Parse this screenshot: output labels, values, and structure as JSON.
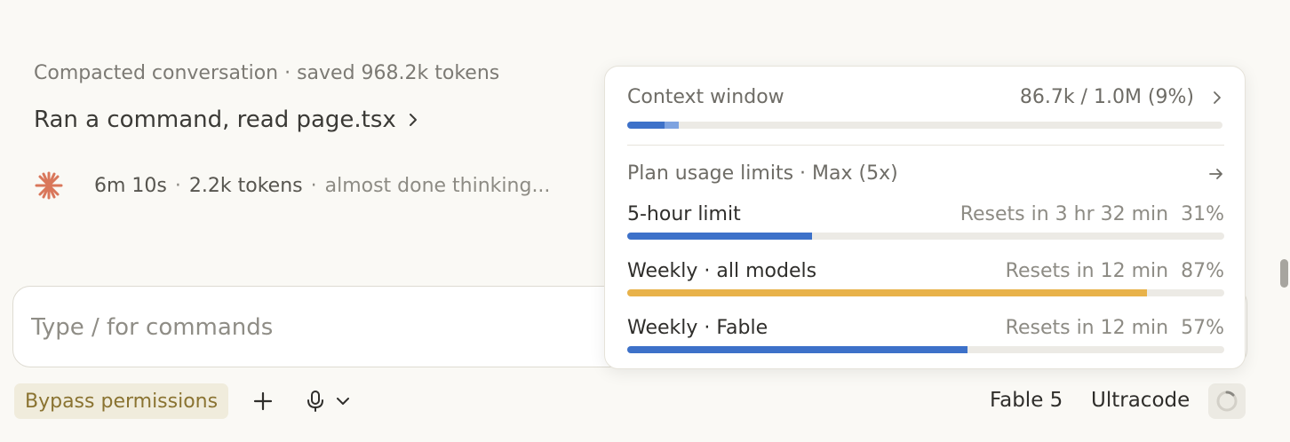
{
  "conversation": {
    "compact_note": "Compacted conversation · saved 968.2k tokens",
    "ran_command": "Ran a command, read page.tsx",
    "thinking": {
      "elapsed": "6m 10s",
      "sep1": "·",
      "tokens": "2.2k tokens",
      "sep2": "·",
      "status": "almost done thinking..."
    }
  },
  "composer": {
    "placeholder": "Type / for commands",
    "value": ""
  },
  "toolbar": {
    "permission_mode": "Bypass permissions",
    "model": "Fable 5",
    "mode": "Ultracode"
  },
  "usage_popover": {
    "context": {
      "title": "Context window",
      "value": "86.7k / 1.0M (9%)",
      "fraction": 0.087,
      "cached_fraction": 0.062
    },
    "plan": {
      "title": "Plan usage limits · Max (5x)"
    },
    "limits": [
      {
        "name": "5-hour limit",
        "reset": "Resets in 3 hr 32 min",
        "percent_label": "31%",
        "fraction": 0.31,
        "color": "#3d71c9"
      },
      {
        "name": "Weekly · all models",
        "reset": "Resets in 12 min",
        "percent_label": "87%",
        "fraction": 0.87,
        "color": "#e8b24a"
      },
      {
        "name": "Weekly · Fable",
        "reset": "Resets in 12 min",
        "percent_label": "57%",
        "fraction": 0.57,
        "color": "#3d71c9"
      }
    ]
  },
  "colors": {
    "accent_blue": "#3d71c9",
    "accent_blue_light": "#7ea3e0",
    "warning_amber": "#e8b24a",
    "spark_orange": "#d9775b",
    "bypass_text": "#8a7331"
  },
  "icons": {
    "spark": "asterisk-spark-icon",
    "chevron": "chevron-right-icon",
    "arrow": "arrow-right-icon",
    "plus": "plus-icon",
    "mic": "microphone-icon",
    "dropdown": "chevron-down-icon",
    "usage": "usage-ring-icon"
  }
}
